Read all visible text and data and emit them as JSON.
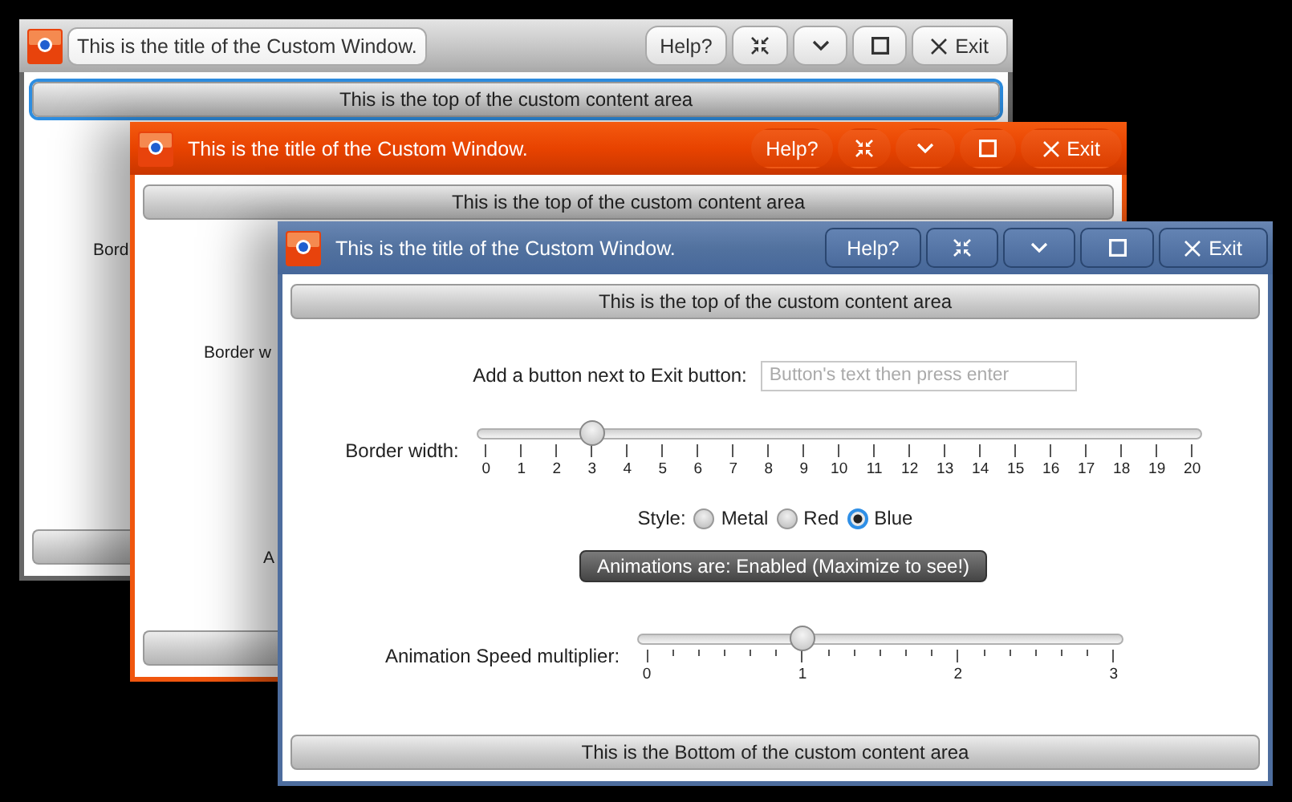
{
  "windows": [
    {
      "title": "This is the title of the Custom Window.",
      "buttons": [
        {
          "kind": "text",
          "label": "Help?"
        },
        {
          "kind": "fullscreen"
        },
        {
          "kind": "dropdown"
        },
        {
          "kind": "maximize"
        },
        {
          "kind": "exit",
          "label": "Exit"
        }
      ],
      "top_bar": {
        "label": "This is the top of the custom content area",
        "focused": true
      },
      "rows": [
        {
          "kind": "width-slider",
          "label": "Bord"
        }
      ]
    },
    {
      "title": "This is the title of the Custom Window.",
      "buttons": [
        {
          "kind": "text",
          "label": "Help?"
        },
        {
          "kind": "fullscreen"
        },
        {
          "kind": "dropdown"
        },
        {
          "kind": "maximize"
        },
        {
          "kind": "exit",
          "label": "Exit"
        }
      ],
      "top_bar": {
        "label": "This is the top of the custom content area",
        "focused": false
      },
      "rows": [
        {
          "kind": "width-slider",
          "label": "Border w"
        },
        {
          "kind": "speed-slider",
          "label": "A"
        }
      ]
    },
    {
      "title": "This is the title of the Custom Window.",
      "buttons": [
        {
          "kind": "text",
          "label": "Help?"
        },
        {
          "kind": "fullscreen"
        },
        {
          "kind": "dropdown"
        },
        {
          "kind": "maximize"
        },
        {
          "kind": "exit",
          "label": "Exit"
        }
      ],
      "top_bar": {
        "label": "This is the top of the custom content area",
        "focused": false
      },
      "bottom_bar": {
        "label": "This is the Bottom of the custom content area"
      },
      "rows": [
        {
          "kind": "text-input",
          "label": "Add a button next to Exit button:",
          "placeholder": "Button's text then press enter"
        },
        {
          "kind": "width-slider",
          "label": "Border width:",
          "level": 0.15,
          "ticks": [
            "0",
            "1",
            "2",
            "3",
            "4",
            "5",
            "6",
            "7",
            "8",
            "9",
            "10",
            "11",
            "12",
            "13",
            "14",
            "15",
            "16",
            "17",
            "18",
            "19",
            "20"
          ]
        },
        {
          "kind": "style-radios",
          "label": "Style:",
          "options": [
            {
              "label": "Metal",
              "selected": false
            },
            {
              "label": "Red",
              "selected": false
            },
            {
              "label": "Blue",
              "selected": true
            }
          ]
        },
        {
          "kind": "toggle",
          "label": "Animations are: Enabled (Maximize to see!)"
        },
        {
          "kind": "speed-slider",
          "label": "Animation Speed multiplier:",
          "level": 0.3333,
          "ticks": [
            "0",
            "1",
            "2",
            "3"
          ]
        }
      ]
    }
  ]
}
